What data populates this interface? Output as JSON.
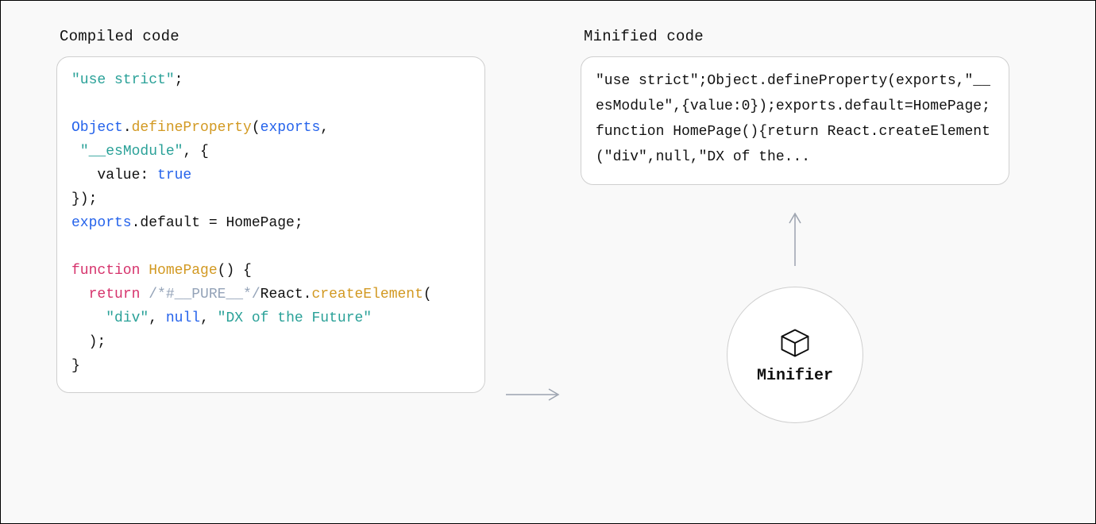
{
  "labels": {
    "compiled_title": "Compiled code",
    "minified_title": "Minified code",
    "minifier": "Minifier"
  },
  "colors": {
    "string": "#2aa198",
    "keyword": "#d6336c",
    "function": "#d29922",
    "identifier": "#2563eb",
    "comment": "#94a3b8",
    "panel_border": "#cfcfcf",
    "outer_border": "#000000",
    "background": "#f9f9f9",
    "arrow": "#9ca3af"
  },
  "compiled_tokens": [
    [
      [
        "str",
        "\"use strict\""
      ],
      [
        "plain",
        ";"
      ]
    ],
    [],
    [
      [
        "id",
        "Object"
      ],
      [
        "plain",
        "."
      ],
      [
        "fn",
        "defineProperty"
      ],
      [
        "plain",
        "("
      ],
      [
        "id",
        "exports"
      ],
      [
        "plain",
        ","
      ]
    ],
    [
      [
        "plain",
        " "
      ],
      [
        "str",
        "\"__esModule\""
      ],
      [
        "plain",
        ", {"
      ]
    ],
    [
      [
        "plain",
        "   value: "
      ],
      [
        "bool",
        "true"
      ]
    ],
    [
      [
        "plain",
        "});"
      ]
    ],
    [
      [
        "id",
        "exports"
      ],
      [
        "plain",
        ".default = HomePage;"
      ]
    ],
    [],
    [
      [
        "kw",
        "function"
      ],
      [
        "plain",
        " "
      ],
      [
        "fn",
        "HomePage"
      ],
      [
        "plain",
        "() {"
      ]
    ],
    [
      [
        "plain",
        "  "
      ],
      [
        "kw",
        "return"
      ],
      [
        "plain",
        " "
      ],
      [
        "cm",
        "/*#__PURE__*/"
      ],
      [
        "plain",
        "React."
      ],
      [
        "fn",
        "createElement"
      ],
      [
        "plain",
        "("
      ]
    ],
    [
      [
        "plain",
        "    "
      ],
      [
        "str",
        "\"div\""
      ],
      [
        "plain",
        ", "
      ],
      [
        "id",
        "null"
      ],
      [
        "plain",
        ", "
      ],
      [
        "str",
        "\"DX of the Future\""
      ]
    ],
    [
      [
        "plain",
        "  );"
      ]
    ],
    [
      [
        "plain",
        "}"
      ]
    ]
  ],
  "minified_text": "\"use strict\";Object.defineProperty(exports,\"__esModule\",{value:0});exports.default=HomePage;function HomePage(){return React.createElement(\"div\",null,\"DX of the...",
  "compiled_source": "\"use strict\";\n\nObject.defineProperty(exports,\n \"__esModule\", {\n   value: true\n});\nexports.default = HomePage;\n\nfunction HomePage() {\n  return /*#__PURE__*/React.createElement(\n    \"div\", null, \"DX of the Future\"\n  );\n}"
}
